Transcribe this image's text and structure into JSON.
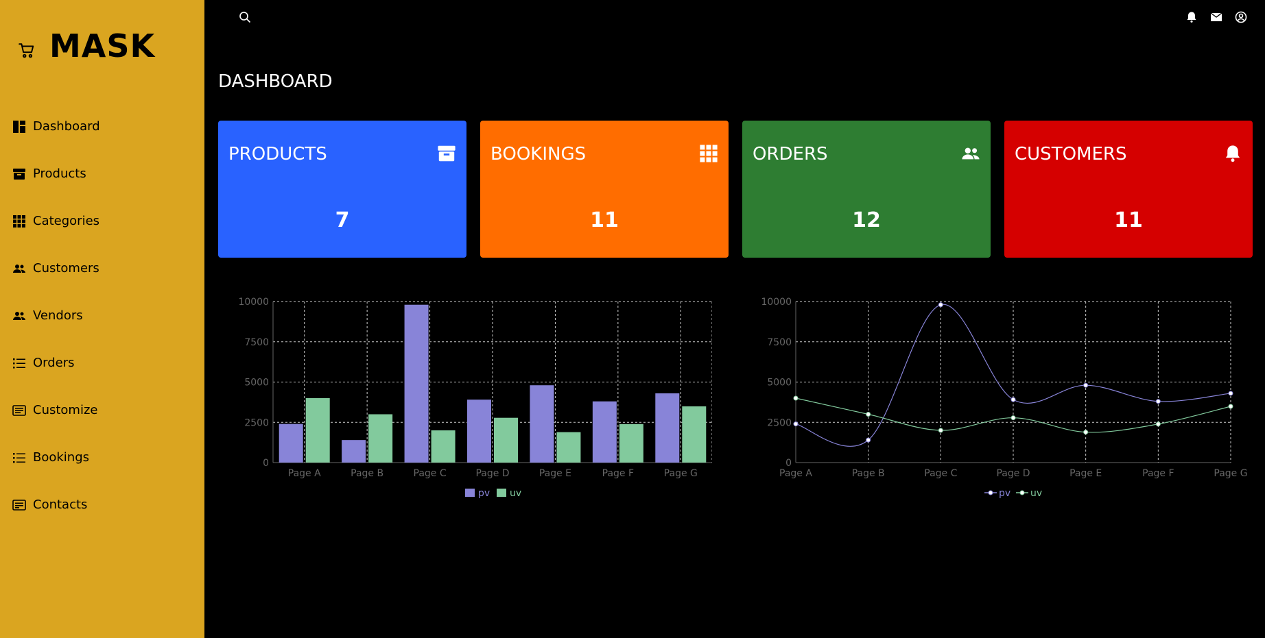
{
  "brand": {
    "name": "MASK",
    "icon": "cart-icon"
  },
  "sidebar": {
    "items": [
      {
        "label": "Dashboard",
        "icon": "dashboard-icon"
      },
      {
        "label": "Products",
        "icon": "archive-icon"
      },
      {
        "label": "Categories",
        "icon": "grid-icon"
      },
      {
        "label": "Customers",
        "icon": "people-icon"
      },
      {
        "label": "Vendors",
        "icon": "people-icon"
      },
      {
        "label": "Orders",
        "icon": "list-icon"
      },
      {
        "label": "Customize",
        "icon": "sliders-icon"
      },
      {
        "label": "Bookings",
        "icon": "list-icon"
      },
      {
        "label": "Contacts",
        "icon": "card-icon"
      }
    ]
  },
  "header": {
    "title": "DASHBOARD"
  },
  "cards": [
    {
      "title": "PRODUCTS",
      "value": "7",
      "color": "#2962ff",
      "icon": "archive-icon"
    },
    {
      "title": "BOOKINGS",
      "value": "11",
      "color": "#ff6d00",
      "icon": "grid-icon"
    },
    {
      "title": "ORDERS",
      "value": "12",
      "color": "#2e7d32",
      "icon": "people-icon"
    },
    {
      "title": "CUSTOMERS",
      "value": "11",
      "color": "#d50000",
      "icon": "bell-icon"
    }
  ],
  "chart_data": [
    {
      "type": "bar",
      "categories": [
        "Page A",
        "Page B",
        "Page C",
        "Page D",
        "Page E",
        "Page F",
        "Page G"
      ],
      "series": [
        {
          "name": "pv",
          "values": [
            2400,
            1398,
            9800,
            3908,
            4800,
            3800,
            4300
          ],
          "color": "#8884d8"
        },
        {
          "name": "uv",
          "values": [
            4000,
            3000,
            2000,
            2780,
            1890,
            2390,
            3490
          ],
          "color": "#82ca9d"
        }
      ],
      "ylim": [
        0,
        10000
      ],
      "yticks": [
        "0",
        "2500",
        "5000",
        "7500",
        "10000"
      ],
      "grid": true,
      "legend": "bottom"
    },
    {
      "type": "line",
      "categories": [
        "Page A",
        "Page B",
        "Page C",
        "Page D",
        "Page E",
        "Page F",
        "Page G"
      ],
      "series": [
        {
          "name": "pv",
          "values": [
            2400,
            1398,
            9800,
            3908,
            4800,
            3800,
            4300
          ],
          "color": "#8884d8"
        },
        {
          "name": "uv",
          "values": [
            4000,
            3000,
            2000,
            2780,
            1890,
            2390,
            3490
          ],
          "color": "#82ca9d"
        }
      ],
      "ylim": [
        0,
        10000
      ],
      "yticks": [
        "0",
        "2500",
        "5000",
        "7500",
        "10000"
      ],
      "grid": true,
      "legend": "bottom"
    }
  ]
}
